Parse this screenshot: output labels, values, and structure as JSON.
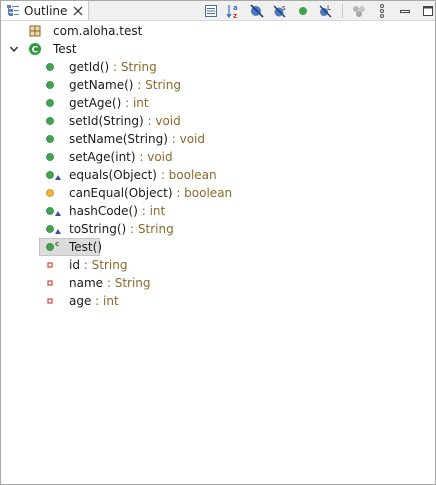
{
  "view": {
    "tab_label": "Outline"
  },
  "toolbar": {
    "buttons": [
      "collapse-all-icon",
      "sort-alphabetically-icon",
      "hide-fields-icon",
      "hide-static-icon",
      "hide-non-public-icon",
      "hide-local-types-icon",
      "focus-icon",
      "view-menu-icon",
      "minimize-icon",
      "maximize-icon"
    ]
  },
  "tree": {
    "package": "com.aloha.test",
    "class": "Test",
    "members": [
      {
        "name": "getId()",
        "sep": " : ",
        "type": "String",
        "kind": "method-public"
      },
      {
        "name": "getName()",
        "sep": " : ",
        "type": "String",
        "kind": "method-public"
      },
      {
        "name": "getAge()",
        "sep": " : ",
        "type": "int",
        "kind": "method-public"
      },
      {
        "name": "setId(String)",
        "sep": " : ",
        "type": "void",
        "kind": "method-public"
      },
      {
        "name": "setName(String)",
        "sep": " : ",
        "type": "void",
        "kind": "method-public"
      },
      {
        "name": "setAge(int)",
        "sep": " : ",
        "type": "void",
        "kind": "method-public"
      },
      {
        "name": "equals(Object)",
        "sep": " : ",
        "type": "boolean",
        "kind": "method-public-override"
      },
      {
        "name": "canEqual(Object)",
        "sep": " : ",
        "type": "boolean",
        "kind": "method-protected"
      },
      {
        "name": "hashCode()",
        "sep": " : ",
        "type": "int",
        "kind": "method-public-override"
      },
      {
        "name": "toString()",
        "sep": " : ",
        "type": "String",
        "kind": "method-public-override"
      },
      {
        "name": "Test()",
        "sep": "",
        "type": "",
        "kind": "constructor",
        "selected": true
      },
      {
        "name": "id",
        "sep": " : ",
        "type": "String",
        "kind": "field-private"
      },
      {
        "name": "name",
        "sep": " : ",
        "type": "String",
        "kind": "field-private"
      },
      {
        "name": "age",
        "sep": " : ",
        "type": "int",
        "kind": "field-private"
      }
    ]
  },
  "colors": {
    "public_method": "#3fa34d",
    "protected_method": "#f2b431",
    "private_field": "#d0463f",
    "class_icon": "#2e9b3a",
    "type_text": "#8a6a2a"
  }
}
